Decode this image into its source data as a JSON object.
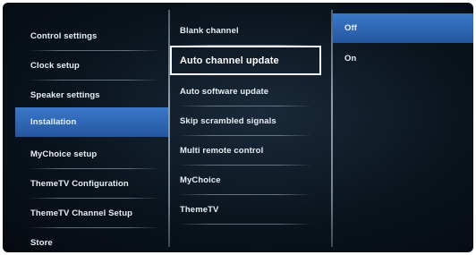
{
  "left_menu": {
    "items": [
      {
        "label": "Control settings"
      },
      {
        "label": "Clock setup"
      },
      {
        "label": "Speaker settings"
      },
      {
        "label": "Installation"
      },
      {
        "label": "MyChoice setup"
      },
      {
        "label": "ThemeTV Configuration"
      },
      {
        "label": "ThemeTV Channel Setup"
      },
      {
        "label": "Store"
      }
    ],
    "selected_index": 3
  },
  "middle_menu": {
    "items": [
      {
        "label": "Blank channel"
      },
      {
        "label": "Auto channel update"
      },
      {
        "label": "Auto software update"
      },
      {
        "label": "Skip scrambled signals"
      },
      {
        "label": "Multi remote control"
      },
      {
        "label": "MyChoice"
      },
      {
        "label": "ThemeTV"
      }
    ],
    "focused_index": 1
  },
  "options_menu": {
    "items": [
      {
        "label": "Off"
      },
      {
        "label": "On"
      }
    ],
    "selected_index": 0
  },
  "colors": {
    "highlight": "#2f6bb8",
    "focus_border": "#f4f8fc",
    "background": "#0b1620"
  }
}
